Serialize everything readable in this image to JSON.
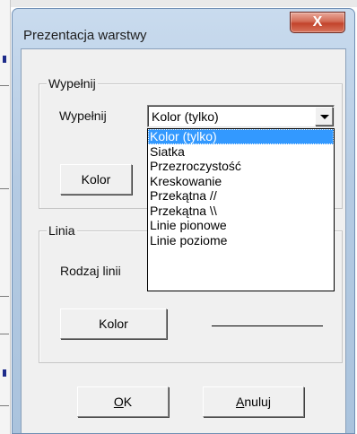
{
  "window": {
    "title": "Prezentacja warstwy",
    "close_label": "X"
  },
  "fill_group": {
    "legend": "Wypełnij",
    "label": "Wypełnij",
    "combo_value": "Kolor (tylko)",
    "color_button": "Kolor",
    "options": [
      "Kolor (tylko)",
      "Siatka",
      "Przezroczystość",
      "Kreskowanie",
      "Przekątna //",
      "Przekątna \\\\",
      "Linie pionowe",
      "Linie poziome"
    ]
  },
  "line_group": {
    "legend": "Linia",
    "label": "Rodzaj linii",
    "color_button": "Kolor"
  },
  "footer": {
    "ok_underline": "O",
    "ok_rest": "K",
    "cancel_underline": "A",
    "cancel_rest": "nuluj"
  }
}
